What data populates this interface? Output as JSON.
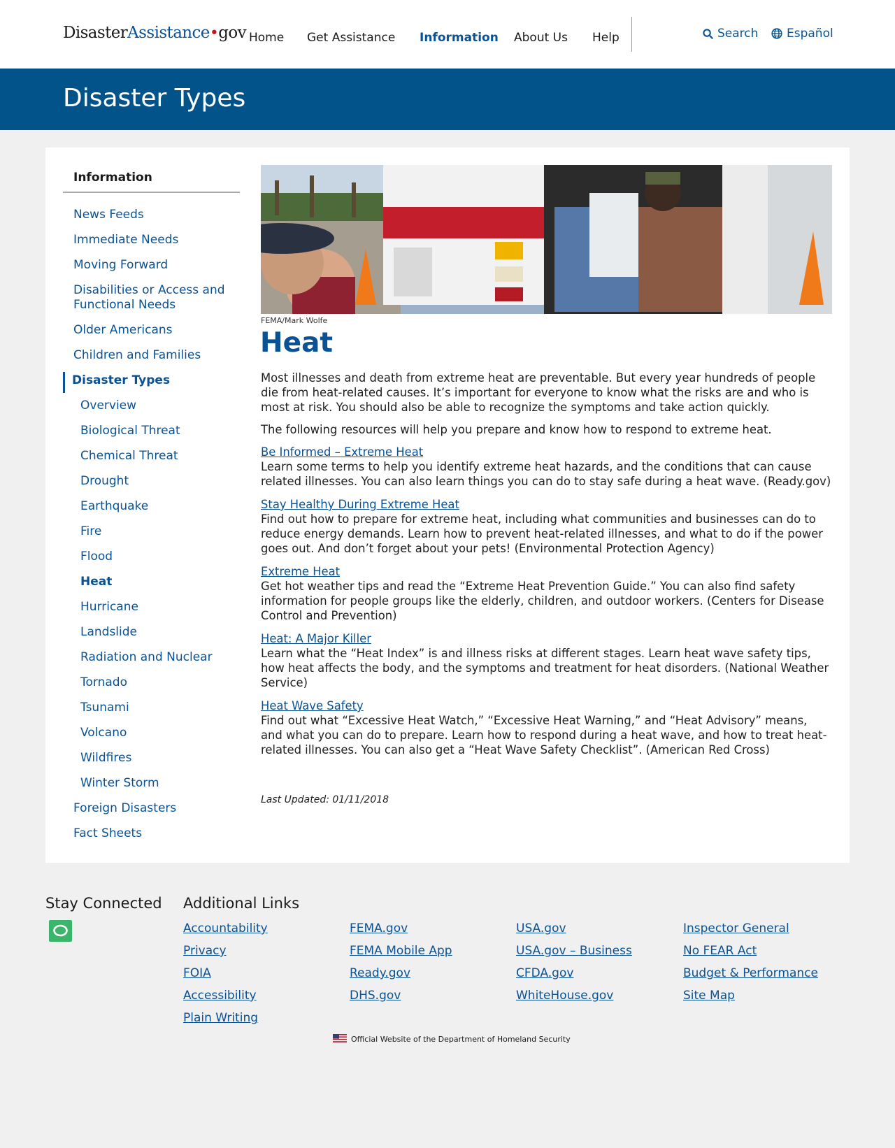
{
  "header": {
    "logo": {
      "part1": "Disaster",
      "part2": "Assistance",
      "dot": "•",
      "part3": "gov"
    },
    "nav": [
      "Home",
      "Get Assistance",
      "Information",
      "About Us",
      "Help"
    ],
    "active_nav": "Information",
    "search_label": "Search",
    "language_label": "Español"
  },
  "banner": {
    "title": "Disaster Types"
  },
  "sidebar": {
    "heading": "Information",
    "top_items": [
      "News Feeds",
      "Immediate Needs",
      "Moving Forward",
      "Disabilities or Access and Functional Needs",
      "Older Americans",
      "Children and Families"
    ],
    "section_label": "Disaster Types",
    "sub_items": [
      "Overview",
      "Biological Threat",
      "Chemical Threat",
      "Drought",
      "Earthquake",
      "Fire",
      "Flood",
      "Heat",
      "Hurricane",
      "Landslide",
      "Radiation and Nuclear",
      "Tornado",
      "Tsunami",
      "Volcano",
      "Wildfires",
      "Winter Storm"
    ],
    "current_sub_item": "Heat",
    "bottom_items": [
      "Foreign Disasters",
      "Fact Sheets"
    ]
  },
  "content": {
    "photo_credit": "FEMA/Mark Wolfe",
    "title": "Heat",
    "intro": "Most illnesses and death from extreme heat are preventable. But every year hundreds of people die from heat-related causes. It’s important for everyone to know what the risks are and who is most at risk. You should also be able to recognize the symptoms and take action quickly.",
    "lead": "The following resources will help you prepare and know how to respond to extreme heat.",
    "resources": [
      {
        "title": "Be Informed – Extreme Heat",
        "description": "Learn some terms to help you identify extreme heat hazards, and the conditions that can cause related illnesses. You can also learn things you can do to stay safe during a heat wave. (Ready.gov)"
      },
      {
        "title": "Stay Healthy During Extreme Heat",
        "description": "Find out how to prepare for extreme heat, including what communities and businesses can do to reduce energy demands. Learn how to prevent heat-related illnesses, and what to do if the power goes out. And don’t forget about your pets! (Environmental Protection Agency)"
      },
      {
        "title": "Extreme Heat",
        "description": "Get hot weather tips and read the “Extreme Heat Prevention Guide.” You can also find safety information for people groups like the elderly, children, and outdoor workers. (Centers for Disease Control and Prevention)"
      },
      {
        "title": "Heat: A Major Killer",
        "description": "Learn what the “Heat Index” is and illness risks at different stages. Learn heat wave safety tips, how heat affects the body, and the symptoms and treatment for heat disorders. (National Weather Service)"
      },
      {
        "title": "Heat Wave Safety",
        "description": "Find out what “Excessive Heat Watch,” “Excessive Heat Warning,” and “Heat Advisory” means, and what you can do to prepare. Learn how to respond during a heat wave, and how to treat heat-related illnesses. You can also get a “Heat Wave Safety Checklist”. (American Red Cross)"
      }
    ],
    "last_updated": "Last Updated: 01/11/2018"
  },
  "footer": {
    "stay_connected": "Stay Connected",
    "additional_links": "Additional Links",
    "columns": [
      [
        "Accountability",
        "Privacy",
        "FOIA",
        "Accessibility",
        "Plain Writing"
      ],
      [
        "FEMA.gov",
        "FEMA Mobile App",
        "Ready.gov",
        "DHS.gov"
      ],
      [
        "USA.gov",
        "USA.gov – Business",
        "CFDA.gov",
        "WhiteHouse.gov"
      ],
      [
        "Inspector General",
        "No FEAR Act",
        "Budget & Performance",
        "Site Map"
      ]
    ],
    "official": "Official Website of the Department of Homeland Security"
  },
  "colors": {
    "brand_blue": "#02538a",
    "link_blue": "#0b5294",
    "chat_green": "#3ab56b",
    "logo_red": "#c4161c"
  }
}
